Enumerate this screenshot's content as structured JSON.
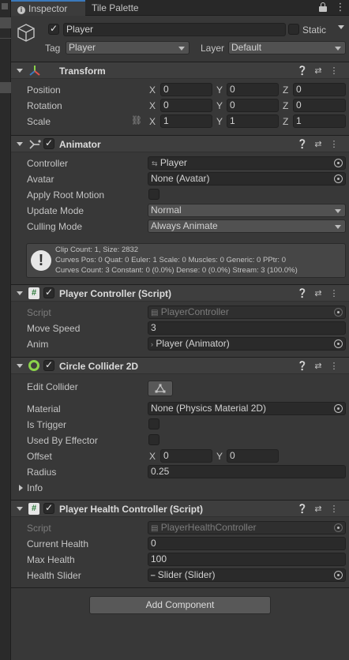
{
  "tabs": {
    "inspector": "Inspector",
    "tile_palette": "Tile Palette"
  },
  "object": {
    "name": "Player",
    "static_label": "Static",
    "tag_label": "Tag",
    "tag_value": "Player",
    "layer_label": "Layer",
    "layer_value": "Default"
  },
  "transform": {
    "title": "Transform",
    "position_label": "Position",
    "rotation_label": "Rotation",
    "scale_label": "Scale",
    "x": "X",
    "y": "Y",
    "z": "Z",
    "position": [
      "0",
      "0",
      "0"
    ],
    "rotation": [
      "0",
      "0",
      "0"
    ],
    "scale": [
      "1",
      "1",
      "1"
    ]
  },
  "animator": {
    "title": "Animator",
    "controller_label": "Controller",
    "controller_value": "Player",
    "avatar_label": "Avatar",
    "avatar_value": "None (Avatar)",
    "apply_root_motion_label": "Apply Root Motion",
    "update_mode_label": "Update Mode",
    "update_mode_value": "Normal",
    "culling_mode_label": "Culling Mode",
    "culling_mode_value": "Always Animate",
    "info_line1": "Clip Count: 1, Size: 2832",
    "info_line2": "Curves Pos: 0 Quat: 0 Euler: 1 Scale: 0 Muscles: 0 Generic: 0 PPtr: 0",
    "info_line3": "Curves Count: 3 Constant: 0 (0.0%) Dense: 0 (0.0%) Stream: 3 (100.0%)"
  },
  "player_controller": {
    "title": "Player Controller (Script)",
    "script_label": "Script",
    "script_value": "PlayerController",
    "move_speed_label": "Move Speed",
    "move_speed_value": "3",
    "anim_label": "Anim",
    "anim_value": "Player (Animator)"
  },
  "circle_collider": {
    "title": "Circle Collider 2D",
    "edit_collider_label": "Edit Collider",
    "material_label": "Material",
    "material_value": "None (Physics Material 2D)",
    "is_trigger_label": "Is Trigger",
    "used_by_effector_label": "Used By Effector",
    "offset_label": "Offset",
    "x": "X",
    "y": "Y",
    "offset": [
      "0",
      "0"
    ],
    "radius_label": "Radius",
    "radius_value": "0.25",
    "info_label": "Info"
  },
  "player_health": {
    "title": "Player Health Controller (Script)",
    "script_label": "Script",
    "script_value": "PlayerHealthController",
    "current_health_label": "Current Health",
    "current_health_value": "0",
    "max_health_label": "Max Health",
    "max_health_value": "100",
    "health_slider_label": "Health Slider",
    "health_slider_value": "Slider (Slider)"
  },
  "add_component_label": "Add Component",
  "colors": {
    "accent_blue": "#3a79bb",
    "panel_bg": "#383838",
    "field_bg": "#2a2a2a",
    "collider_green": "#8bd34b",
    "transform_red": "#e0514a"
  }
}
